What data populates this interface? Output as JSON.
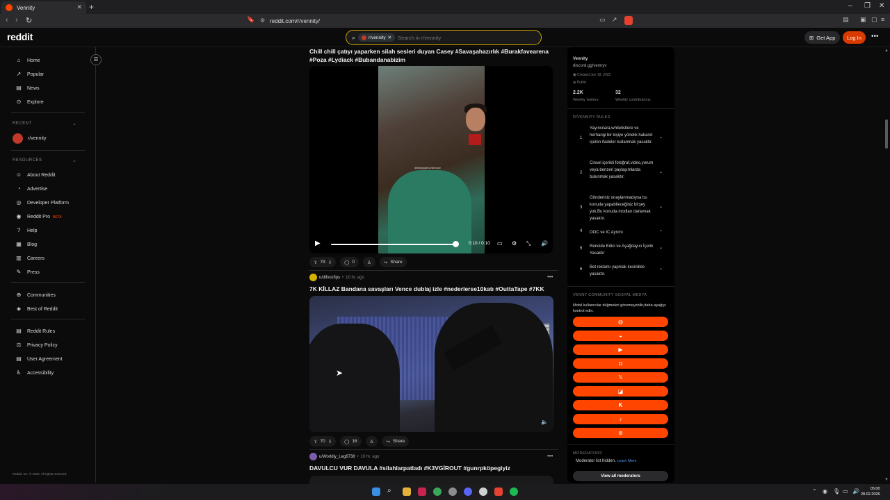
{
  "browser": {
    "tab_title": "Vennity",
    "url": "reddit.com/r/vennity/"
  },
  "header": {
    "logo": "reddit",
    "search_chip": "r/vennity",
    "search_placeholder": "Search in r/vennity",
    "get_app": "Get App",
    "login": "Log In"
  },
  "sidebar": {
    "nav": [
      "Home",
      "Popular",
      "News",
      "Explore"
    ],
    "recent_heading": "RECENT",
    "recent_item": "r/vennity",
    "resources_heading": "RESOURCES",
    "resources": [
      "About Reddit",
      "Advertise",
      "Developer Platform",
      "Reddit Pro",
      "Help",
      "Blog",
      "Careers",
      "Press"
    ],
    "beta": "BETA",
    "community": [
      "Communities",
      "Best of Reddit"
    ],
    "legal": [
      "Reddit Rules",
      "Privacy Policy",
      "User Agreement",
      "Accessibility"
    ],
    "copyright": "Reddit, Inc. © 2026. All rights reserved."
  },
  "posts": [
    {
      "title": "Chill chill çatıyı yaparken silah sesleri duyan Casey #Savaşahazırlık #Burakfavearena #Poza #Lydiack #Bubandanabizim",
      "video_time": "0:10 / 0:10",
      "watermark": "@instagram/varhostv",
      "upvotes": "79",
      "comments": "0",
      "share": "Share"
    },
    {
      "author": "u/difvozfips",
      "time": "10 hr. ago",
      "title": "7K KİLLAZ Bandana savaşları Vence dublaj izle #nederlerse10katı #OuttaTape #7KK",
      "upvotes": "70",
      "comments": "16",
      "share": "Share"
    },
    {
      "author": "u/Worldly_Leg6738",
      "time": "10 hr. ago",
      "title": "DAVULCU VUR DAVULA #silahlarpatladı #K3VGİROUT #gunrpköpegiyiz"
    }
  ],
  "community": {
    "name": "Vennity",
    "link": "discord.gg/vennyv",
    "created": "Created Jun 18, 2025",
    "visibility": "Public",
    "visitors_value": "2.2K",
    "visitors_label": "Weekly visitors",
    "contrib_value": "32",
    "contrib_label": "Weekly contributions",
    "rules_heading": "R/VENNITY RULES",
    "rules": [
      {
        "n": "1",
        "text": "Yayıncılara,whitelistlere ve herhangi bir kişiye yönelik hakaret içeren ifadeler kullanmak yasaktır."
      },
      {
        "n": "2",
        "text": "Cinsel içerikli fotoğraf,video,yorum veya benzeri paylaşımlarda bulunmak yasaktır."
      },
      {
        "n": "3",
        "text": "Gönderiniz onaylanmadıysa bu konuda yapabileceğiniz birşey yok.Bu konuda modları darlamak yasaktır."
      },
      {
        "n": "4",
        "text": "OOC ve IC Ayrımı"
      },
      {
        "n": "5",
        "text": "Rencide Edici ve Aşağılayıcı İçerik Yasaktır"
      },
      {
        "n": "6",
        "text": "Bet reklamı yapmak kesinlikle yasaktır."
      }
    ],
    "social_heading": "VENNY COMMUNITY SOSYAL MEDYA",
    "social_desc": "Mobil kullanıcılar düğmeleri göremeyebilir,daha aşağıyı kontrol edin.",
    "social_icons": [
      "globe-icon",
      "discord-icon",
      "youtube-icon",
      "instagram-icon",
      "x-icon",
      "twitch-icon",
      "kick-icon",
      "tiktok-icon",
      "steam-icon"
    ],
    "moderators_heading": "MODERATORS",
    "moderators_text": "Moderator list hidden.",
    "learn_more": "Learn More",
    "view_all": "View all moderators"
  },
  "taskbar": {
    "time": "05:00",
    "date": "28.02.2026"
  },
  "colors": {
    "accent": "#ff4500",
    "login": "#d93a00",
    "search_border": "#d1a400"
  }
}
